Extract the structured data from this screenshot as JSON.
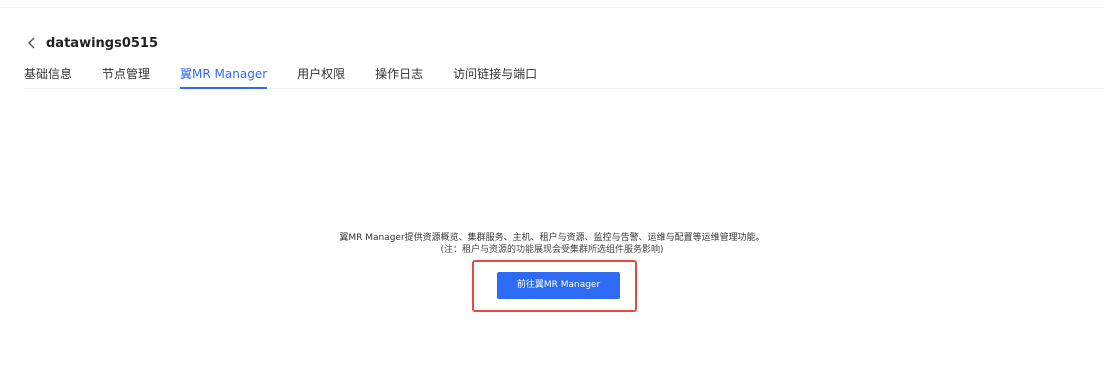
{
  "header": {
    "back_icon": "chevron-left-icon",
    "title": "datawings0515"
  },
  "tabs": [
    {
      "label": "基础信息",
      "active": false
    },
    {
      "label": "节点管理",
      "active": false
    },
    {
      "label": "翼MR Manager",
      "active": true
    },
    {
      "label": "用户权限",
      "active": false
    },
    {
      "label": "操作日志",
      "active": false
    },
    {
      "label": "访问链接与端口",
      "active": false
    }
  ],
  "content": {
    "description": "翼MR Manager提供资源概览、集群服务、主机、租户与资源、监控与告警、运维与配置等运维管理功能。",
    "note": "(注：租户与资源的功能展现会受集群所选组件服务影响)",
    "goto_button": "前往翼MR Manager"
  },
  "colors": {
    "accent": "#2e6bf5",
    "highlight": "#e84a3f"
  }
}
